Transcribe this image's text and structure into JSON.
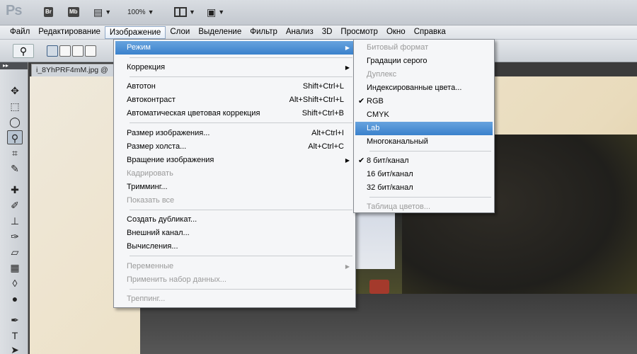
{
  "app": {
    "logo": "Ps",
    "zoom": "100%"
  },
  "titlebar": {
    "br": "Br",
    "mb": "Mb"
  },
  "menubar": [
    "Файл",
    "Редактирование",
    "Изображение",
    "Слои",
    "Выделение",
    "Фильтр",
    "Анализ",
    "3D",
    "Просмотр",
    "Окно",
    "Справка"
  ],
  "document": {
    "tab_title": "i_8YhPRF4mM.jpg @"
  },
  "image_menu": {
    "items": [
      {
        "label": "Режим",
        "submenu": true,
        "highlighted": true
      },
      {
        "label": "Коррекция",
        "submenu": true
      },
      {
        "label": "Автотон",
        "shortcut": "Shift+Ctrl+L"
      },
      {
        "label": "Автоконтраст",
        "shortcut": "Alt+Shift+Ctrl+L"
      },
      {
        "label": "Автоматическая цветовая коррекция",
        "shortcut": "Shift+Ctrl+B"
      },
      {
        "label": "Размер изображения...",
        "shortcut": "Alt+Ctrl+I"
      },
      {
        "label": "Размер холста...",
        "shortcut": "Alt+Ctrl+C"
      },
      {
        "label": "Вращение изображения",
        "submenu": true
      },
      {
        "label": "Кадрировать",
        "disabled": true
      },
      {
        "label": "Тримминг..."
      },
      {
        "label": "Показать все",
        "disabled": true
      },
      {
        "label": "Создать дубликат..."
      },
      {
        "label": "Внешний канал..."
      },
      {
        "label": "Вычисления..."
      },
      {
        "label": "Переменные",
        "submenu": true,
        "disabled": true
      },
      {
        "label": "Применить набор данных...",
        "disabled": true
      },
      {
        "label": "Треппинг...",
        "disabled": true
      }
    ]
  },
  "mode_submenu": {
    "items": [
      {
        "label": "Битовый формат",
        "disabled": true
      },
      {
        "label": "Градации серого"
      },
      {
        "label": "Дуплекс",
        "disabled": true
      },
      {
        "label": "Индексированные цвета..."
      },
      {
        "label": "RGB",
        "checked": true
      },
      {
        "label": "CMYK"
      },
      {
        "label": "Lab",
        "highlighted": true
      },
      {
        "label": "Многоканальный"
      },
      {
        "label": "8 бит/канал",
        "checked": true
      },
      {
        "label": "16 бит/канал"
      },
      {
        "label": "32 бит/канал"
      },
      {
        "label": "Таблица цветов...",
        "disabled": true
      }
    ]
  },
  "glyphs": {
    "submenu_arrow": "▶",
    "check": "✔",
    "caret": "▼"
  },
  "colors": {
    "highlight": "#3a81cc",
    "menu_bg": "#f5f6f8",
    "disabled": "#9a9a9a"
  }
}
